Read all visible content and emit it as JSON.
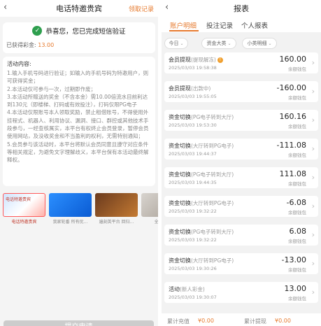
{
  "left": {
    "header": {
      "back_icon": "chevron-left-icon",
      "title": "电话特邀贵宾",
      "link": "领取记录"
    },
    "success": {
      "icon": "check-circle-icon",
      "message": "恭喜您，您已完成短信验证",
      "bonus_label": "已获得彩金:",
      "bonus_amount": "13.00"
    },
    "rules": {
      "title": "活动内容:",
      "items": [
        "1.输入手机号码进行验证；如输入的手机号码为特邀用户，则可获得奖金；",
        "2.本活动仅可参与一次，过期即作废；",
        "3.本活动所赠送的奖金（不含本金）需10.00倍流水目前利达到130元（即楼梯、打码或有效投注），打码仅限PG电子",
        "4.本活动仅限账号本人领取奖励，禁止租借账号，不得使用外挂程式、机器人、利用协议、漏洞、接口、群控或其他技术手段参与，一经查核属实，本平台有权终止会员登录，暂停会员使用网站，及没收奖金和不当盈利的权利，无需特别通知；",
        "5.会员参与该活动时，本平台将默认会员同意且遵守对应条件等相关规定，为避免文字理解歧义，本平台保有本活动最终解释权。"
      ]
    },
    "carousel": [
      {
        "text": "电话特邀贵宾",
        "caption": "电话特邀贵宾"
      },
      {
        "text": "",
        "caption": "我家轮番 所有优..."
      },
      {
        "text": "",
        "caption": "遍刻英平台 回归..."
      },
      {
        "text": "",
        "caption": "全国代..."
      }
    ],
    "submit_label": "提交申请"
  },
  "right": {
    "header": {
      "back_icon": "chevron-left-icon",
      "title": "报表"
    },
    "tabs": [
      "账户明细",
      "投注记录",
      "个人报表"
    ],
    "filters": [
      "今日",
      "资金大类",
      "小类明细"
    ],
    "transactions": [
      {
        "type": "会员提现",
        "sub": "(提现解冻)",
        "has_info": true,
        "time": "2025/03/03 19:58:38",
        "amount": "160.00",
        "wallet": "余额钱包"
      },
      {
        "type": "会员提现",
        "sub": "(出款中)",
        "has_info": false,
        "time": "2025/03/03 19:55:05",
        "amount": "-160.00",
        "wallet": "余额钱包"
      },
      {
        "type": "资金切换",
        "sub": "(PG电子转到大厅)",
        "has_info": false,
        "time": "2025/03/03 19:53:30",
        "amount": "160.16",
        "wallet": "余额钱包"
      },
      {
        "type": "资金切换",
        "sub": "(大厅转到PG电子)",
        "has_info": false,
        "time": "2025/03/03 19:44:37",
        "amount": "-111.08",
        "wallet": "余额钱包"
      },
      {
        "type": "资金切换",
        "sub": "(PG电子转到大厅)",
        "has_info": false,
        "time": "2025/03/03 19:44:35",
        "amount": "111.08",
        "wallet": "余额钱包"
      },
      {
        "type": "资金切换",
        "sub": "(大厅转到PG电子)",
        "has_info": false,
        "time": "2025/03/03 19:32:22",
        "amount": "-6.08",
        "wallet": "余额钱包"
      },
      {
        "type": "资金切换",
        "sub": "(PG电子转到大厅)",
        "has_info": false,
        "time": "2025/03/03 19:32:22",
        "amount": "6.08",
        "wallet": "余额钱包"
      },
      {
        "type": "资金切换",
        "sub": "(大厅转到PG电子)",
        "has_info": false,
        "time": "2025/03/03 19:30:26",
        "amount": "-13.00",
        "wallet": "余额钱包"
      },
      {
        "type": "活动",
        "sub": "(新人彩金)",
        "has_info": false,
        "time": "2025/03/03 19:30:07",
        "amount": "13.00",
        "wallet": "余额钱包"
      }
    ],
    "totals": {
      "recharge_label": "累计充值",
      "recharge_value": "¥0.00",
      "withdraw_label": "累计提现",
      "withdraw_value": "¥0.00"
    }
  }
}
